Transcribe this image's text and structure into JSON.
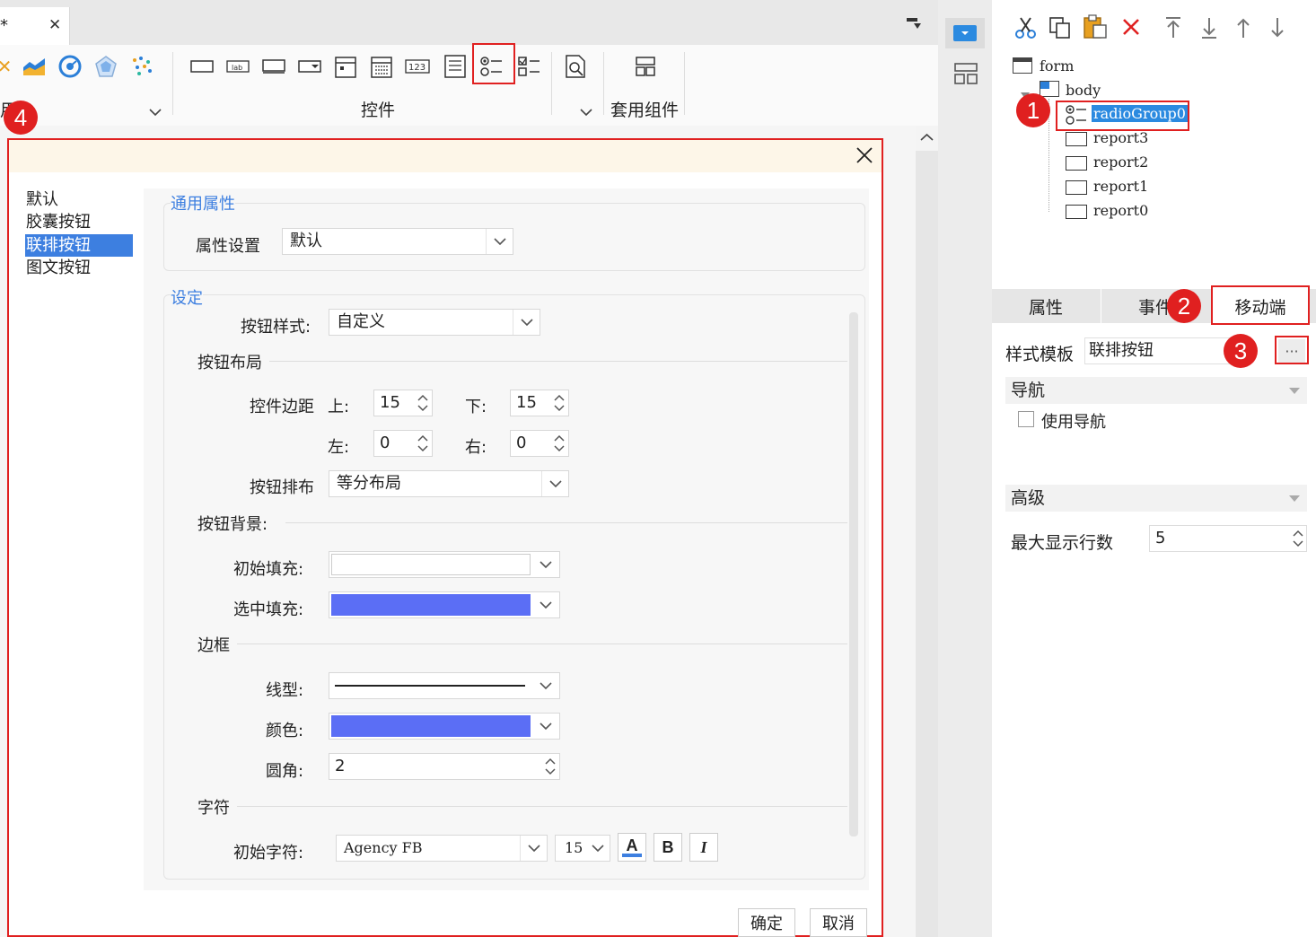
{
  "ribbon": {
    "doc_tab_marker": "*",
    "doc_tab_close": "✕",
    "group_left_label": "用",
    "group_controls_label": "控件",
    "group_template_label": "套用组件"
  },
  "dialog": {
    "list": [
      "默认",
      "胶囊按钮",
      "联排按钮",
      "图文按钮"
    ],
    "general_title": "通用属性",
    "prop_setting_label": "属性设置",
    "prop_setting_value": "默认",
    "settings_title": "设定",
    "btn_style_label": "按钮样式:",
    "btn_style_value": "自定义",
    "layout_section": "按钮布局",
    "margin_label": "控件边距",
    "top_label": "上:",
    "top_value": "15",
    "bottom_label": "下:",
    "bottom_value": "15",
    "left_label": "左:",
    "left_value": "0",
    "right_label": "右:",
    "right_value": "0",
    "arrange_label": "按钮排布",
    "arrange_value": "等分布局",
    "bg_section": "按钮背景:",
    "init_fill_label": "初始填充:",
    "init_fill_color": "#ffffff",
    "sel_fill_label": "选中填充:",
    "sel_fill_color": "#5b6ef5",
    "border_section": "边框",
    "line_type_label": "线型:",
    "color_label": "颜色:",
    "border_color": "#5b6ef5",
    "radius_label": "圆角:",
    "radius_value": "2",
    "font_section": "字符",
    "init_font_label": "初始字符:",
    "font_family_value": "Agency FB",
    "font_size_value": "15",
    "font_color_glyph": "A",
    "bold_glyph": "B",
    "italic_glyph": "I",
    "ok_label": "确定",
    "cancel_label": "取消"
  },
  "tree": {
    "form": "form",
    "body": "body",
    "selected": "radioGroup0",
    "children": [
      "report3",
      "report2",
      "report1",
      "report0"
    ]
  },
  "panel": {
    "tabs": [
      "属性",
      "事件",
      "移动端"
    ],
    "style_template_label": "样式模板",
    "style_template_value": "联排按钮",
    "more_button": "···",
    "nav_section": "导航",
    "use_nav_label": "使用导航",
    "advanced_section": "高级",
    "max_rows_label": "最大显示行数",
    "max_rows_value": "5"
  },
  "badges": [
    "1",
    "2",
    "3",
    "4"
  ],
  "colors": {
    "accent": "#3d7fe0",
    "highlight_red": "#e02020",
    "fill_blue": "#5b6ef5"
  }
}
